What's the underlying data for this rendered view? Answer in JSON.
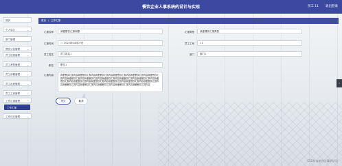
{
  "header": {
    "title": "餐饮企业人事系统的设计与实现",
    "user": "员工 11",
    "logout": "退出登录"
  },
  "sidebar": {
    "items": [
      {
        "label": "首页",
        "expand": false
      },
      {
        "label": "个人中心",
        "expand": true
      },
      {
        "label": "部门管理",
        "expand": false
      },
      {
        "label": "餐饮公告管理",
        "expand": true
      },
      {
        "label": "员工信息管理",
        "expand": true
      },
      {
        "label": "员工考勤管理",
        "expand": true
      },
      {
        "label": "员工请假管理",
        "expand": true
      },
      {
        "label": "员工出差管理",
        "expand": true
      },
      {
        "label": "员工工资管理",
        "expand": true
      },
      {
        "label": "工作汇报管理",
        "expand": true
      },
      {
        "label": "工作汇报",
        "expand": false,
        "active": true
      },
      {
        "label": "工作评价管理",
        "expand": true
      }
    ]
  },
  "breadcrumb": {
    "home": "首页",
    "sep": "/",
    "current": "工作汇报"
  },
  "form": {
    "report_name_label": "汇报名称",
    "report_name": "我爱餐饮汇报标题",
    "report_type_label": "汇报类型",
    "report_type": "我爱餐饮汇报类型",
    "report_time_label": "汇报时间",
    "report_time": "2022年04月07日",
    "employee_id_label": "员工工号",
    "employee_id": "11",
    "employee_name_label": "员工姓名",
    "employee_name": "员工姓名1",
    "department_label": "部门",
    "department": "部门1",
    "position_label": "职位",
    "position": "职位1",
    "content_label": "汇报内容",
    "content": "我爱餐饮汇报内容我爱餐饮汇报内容我爱餐饮汇报内容我爱餐饮汇报内容我爱餐饮汇报内容我爱餐饮汇报内容我爱餐饮汇报内容我爱餐饮汇报内容我爱餐饮汇报内容我爱餐饮汇报内容我爱餐饮汇报内容我爱餐饮汇报内容我爱餐饮汇报内容我爱餐饮汇报内容我爱餐饮汇报内容我爱餐饮汇报内容我爱餐饮汇报内容我爱餐饮汇报内容我爱餐饮汇报内容我爱餐饮汇报内容我爱餐饮汇报内容我爱餐饮汇报内容",
    "submit": "提交",
    "cancel": "取消"
  },
  "watermark": "CSDN @老徐计算机毕设"
}
